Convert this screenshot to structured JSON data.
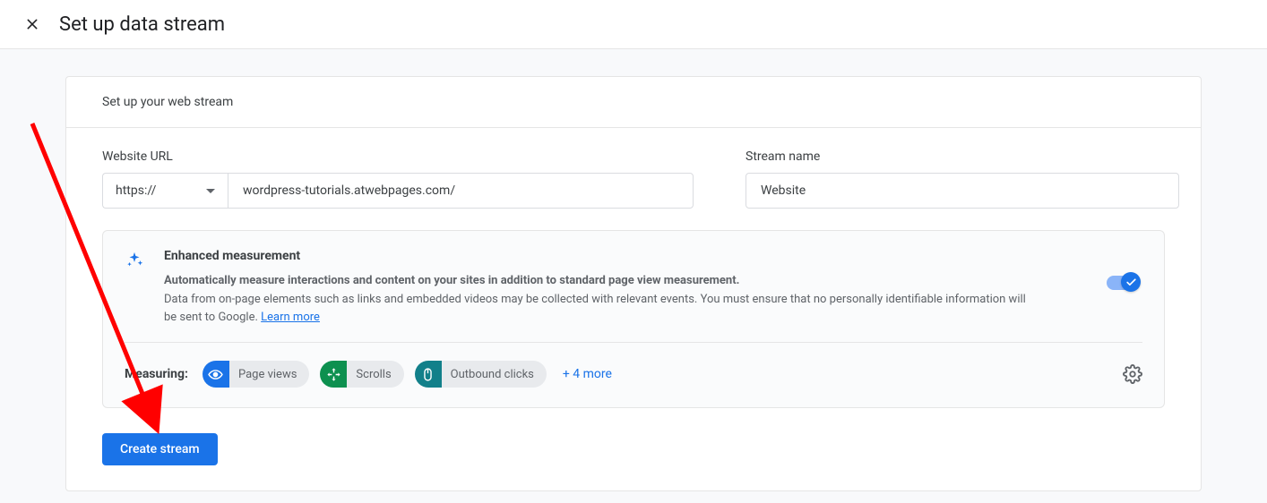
{
  "header": {
    "title": "Set up data stream"
  },
  "card": {
    "section_title": "Set up your web stream",
    "url_label": "Website URL",
    "protocol": "https://",
    "url_value": "wordpress-tutorials.atwebpages.com/",
    "stream_label": "Stream name",
    "stream_value": "Website"
  },
  "enhanced": {
    "title": "Enhanced measurement",
    "bold_line": "Automatically measure interactions and content on your sites in addition to standard page view measurement.",
    "desc_line": "Data from on-page elements such as links and embedded videos may be collected with relevant events. You must ensure that no personally identifiable information will be sent to Google.",
    "learn_more": "Learn more",
    "measuring_label": "Measuring:",
    "chips": {
      "page_views": "Page views",
      "scrolls": "Scrolls",
      "outbound": "Outbound clicks"
    },
    "more": "+ 4 more"
  },
  "actions": {
    "create": "Create stream"
  }
}
